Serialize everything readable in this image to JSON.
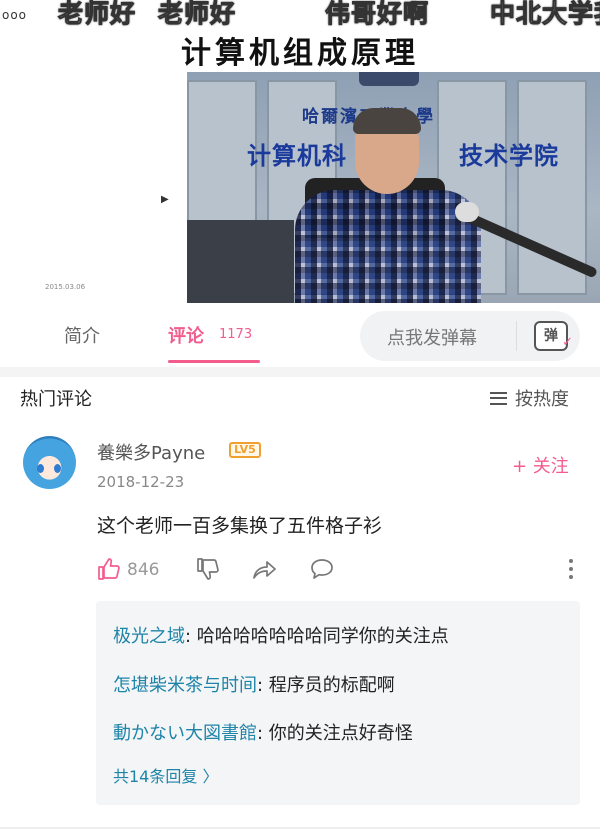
{
  "video": {
    "danmaku": [
      "老师好",
      "老师好",
      "伟哥好啊",
      "中北大学我"
    ],
    "dots": "ooo",
    "title": "计算机组成原理",
    "date_stamp": "2015.03.06",
    "sign_line1": "哈爾濱工業大學",
    "sign_line2_left": "计算机科",
    "sign_line2_right": "技术学院"
  },
  "tabs": {
    "intro": "简介",
    "comments": "评论",
    "comments_count": "1173",
    "danmaku_placeholder": "点我发弹幕",
    "danmaku_icon_text": "弹"
  },
  "comments_header": {
    "title": "热门评论",
    "sort_label": "按热度"
  },
  "comment": {
    "username": "養樂多Payne",
    "level": "LV5",
    "date": "2018-12-23",
    "follow_label": "+ 关注",
    "text": "这个老师一百多集换了五件格子衫",
    "like_count": "846"
  },
  "replies": {
    "items": [
      {
        "name": "极光之域",
        "text": ": 哈哈哈哈哈哈哈同学你的关注点"
      },
      {
        "name": "怎堪柴米茶与时间",
        "text": ": 程序员的标配啊"
      },
      {
        "name": "動かない大図書館",
        "text": ": 你的关注点好奇怪"
      }
    ],
    "total_label": "共14条回复 〉"
  },
  "colors": {
    "accent_pink": "#f25d8e",
    "link_blue": "#1e84a8",
    "level_orange": "#f0a030"
  },
  "icons": [
    "sort-icon",
    "like-icon",
    "dislike-icon",
    "share-icon",
    "reply-icon",
    "more-icon",
    "danmaku-icon"
  ]
}
